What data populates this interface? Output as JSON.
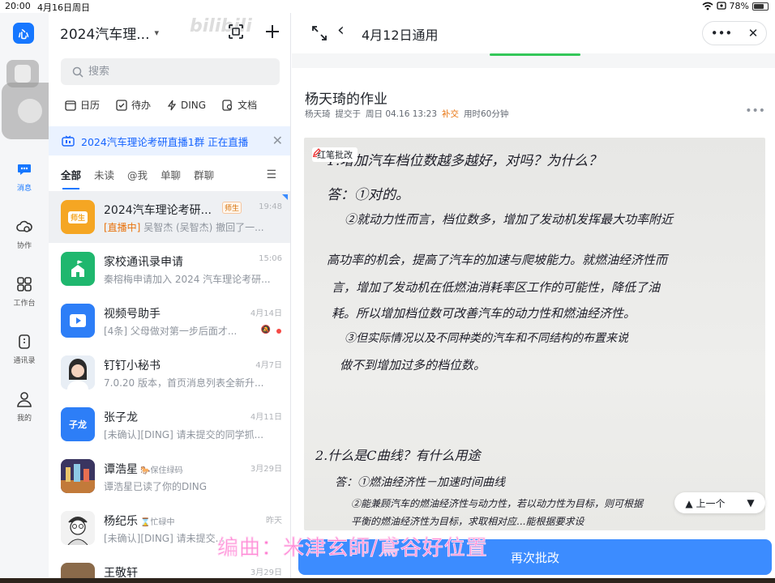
{
  "status": {
    "time": "20:00",
    "date": "4月16日周日",
    "battery": "78%",
    "battery_level": 0.78
  },
  "rail": {
    "logo": "心",
    "items": [
      {
        "label": "消息",
        "icon": "chat-icon"
      },
      {
        "label": "协作",
        "icon": "cloud-doc-icon"
      },
      {
        "label": "工作台",
        "icon": "grid-icon"
      },
      {
        "label": "通讯录",
        "icon": "contacts-icon"
      },
      {
        "label": "我的",
        "icon": "person-icon"
      }
    ]
  },
  "list": {
    "org_title": "2024汽车理...",
    "watermark": "bilibili",
    "search_placeholder": "搜索",
    "quick": [
      "日历",
      "待办",
      "DING",
      "文档"
    ],
    "banner": "2024汽车理论考研直播1群 正在直播",
    "tabs": [
      "全部",
      "未读",
      "@我",
      "单聊",
      "群聊"
    ],
    "conversations": [
      {
        "name": "2024汽车理论考研...",
        "tag": "师生",
        "time": "19:48",
        "live": "[直播中]",
        "preview": " 吴智杰 (吴智杰) 撤回了一...",
        "avatar_text": "师生",
        "avatar_color": "#f5a623"
      },
      {
        "name": "家校通讯录申请",
        "time": "15:06",
        "preview": "秦榕梅申请加入 2024 汽车理论考研...",
        "avatar_text": "",
        "avatar_color": "#1fb76e"
      },
      {
        "name": "视频号助手",
        "time": "4月14日",
        "preview": "[4条] 父母做对第一步后面才...",
        "avatar_text": "",
        "avatar_color": "#2d7ef7"
      },
      {
        "name": "钉钉小秘书",
        "time": "4月7日",
        "preview": "7.0.20 版本，首页消息列表全新升...",
        "avatar_text": "",
        "avatar_color": "#dfe6ee"
      },
      {
        "name": "张子龙",
        "time": "4月11日",
        "preview": "[未确认][DING] 请未提交的同学抓...",
        "avatar_text": "子龙",
        "avatar_color": "#2d7ef7"
      },
      {
        "name": "谭浩星",
        "status": "保住绿码",
        "time": "3月29日",
        "preview": "谭浩星已读了你的DING",
        "avatar_text": "",
        "avatar_color": "#6b5c8a"
      },
      {
        "name": "杨纪乐",
        "status": "忙碌中",
        "time": "昨天",
        "preview": "[未确认][DING] 请未提交...",
        "avatar_text": "",
        "avatar_color": "#e8e8e8"
      },
      {
        "name": "王敬轩",
        "time": "3月29日",
        "preview": "",
        "avatar_text": "",
        "avatar_color": "#8a6a4a"
      }
    ]
  },
  "pane": {
    "title": "4月12日通用",
    "hw_title": "杨天琦的作业",
    "meta_name": "杨天琦",
    "meta_submit": "提交于",
    "meta_time": "周日 04.16 13:23",
    "meta_late": "补交",
    "meta_duration": "用时60分钟",
    "annotate_badge": "红笔批改",
    "prev_label": "上一个",
    "rebutton": "再次批改"
  },
  "handwriting": [
    "1.增加汽车档位数越多越好，对吗？为什么？",
    "答：①对的。",
    "②就动力性而言，档位数多，增加了发动机发挥最大功率附近",
    "高功率的机会，提高了汽车的加速与爬坡能力。就燃油经济性而",
    "言，增加了发动机在低燃油消耗率区工作的可能性，降低了油",
    "耗。所以增加档位数可改善汽车的动力性和燃油经济性。",
    "③但实际情况以及不同种类的汽车和不同结构的布置来说",
    "做不到增加过多的档位数。",
    "2.什么是C曲线？有什么用途",
    "答：①燃油经济性－加速时间曲线",
    "②能兼顾汽车的燃油经济性与动力性，若以动力性为目标，则可根据",
    "平衡的燃油经济性为目标，求取相对应...能根据要求设"
  ],
  "overlay": "编曲：米津玄師/鳶谷好位置"
}
